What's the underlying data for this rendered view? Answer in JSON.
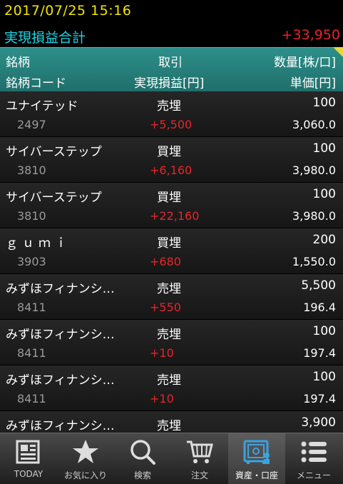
{
  "status": {
    "datetime": "2017/07/25   15:16"
  },
  "summary": {
    "label": "実現損益合計",
    "value": "+33,950"
  },
  "header": {
    "col_name": "銘柄",
    "col_trade": "取引",
    "col_qty": "数量[株/口]",
    "col_code": "銘柄コード",
    "col_pl": "実現損益[円]",
    "col_price": "単価[円]"
  },
  "rows": [
    {
      "name": "ユナイテッド",
      "trade": "売埋",
      "qty": "100",
      "code": "2497",
      "pl": "+5,500",
      "price": "3,060.0"
    },
    {
      "name": "サイバーステップ",
      "trade": "買埋",
      "qty": "100",
      "code": "3810",
      "pl": "+6,160",
      "price": "3,980.0"
    },
    {
      "name": "サイバーステップ",
      "trade": "買埋",
      "qty": "100",
      "code": "3810",
      "pl": "+22,160",
      "price": "3,980.0"
    },
    {
      "name": "ｇｕｍｉ",
      "trade": "買埋",
      "qty": "200",
      "code": "3903",
      "pl": "+680",
      "price": "1,550.0"
    },
    {
      "name": "みずほフィナンシ…",
      "trade": "売埋",
      "qty": "5,500",
      "code": "8411",
      "pl": "+550",
      "price": "196.4"
    },
    {
      "name": "みずほフィナンシ…",
      "trade": "売埋",
      "qty": "100",
      "code": "8411",
      "pl": "+10",
      "price": "197.4"
    },
    {
      "name": "みずほフィナンシ…",
      "trade": "売埋",
      "qty": "100",
      "code": "8411",
      "pl": "+10",
      "price": "197.4"
    },
    {
      "name": "みずほフィナンシ…",
      "trade": "売埋",
      "qty": "3,900",
      "code": "",
      "pl": "",
      "price": ""
    }
  ],
  "tabs": [
    {
      "label": "TODAY",
      "icon": "newspaper-icon"
    },
    {
      "label": "お気に入り",
      "icon": "star-icon"
    },
    {
      "label": "検索",
      "icon": "search-icon"
    },
    {
      "label": "注文",
      "icon": "cart-icon"
    },
    {
      "label": "資産・口座",
      "icon": "safe-icon",
      "active": true
    },
    {
      "label": "メニュー",
      "icon": "menu-list-icon"
    }
  ],
  "colors": {
    "accent_teal": "#1f7a75",
    "profit_red": "#e8242b",
    "date_yellow": "#f2e600",
    "label_cyan": "#19d6e6"
  }
}
